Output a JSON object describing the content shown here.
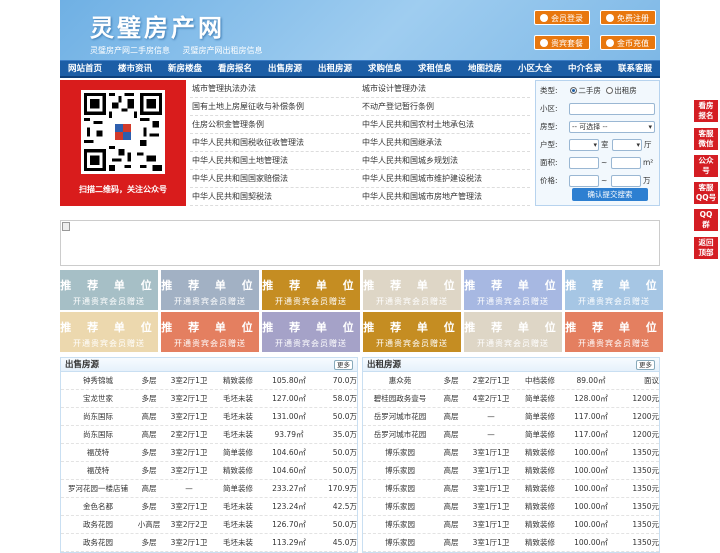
{
  "site": {
    "logo": "灵璧房产网",
    "subtitles": [
      "灵璧房产网二手房信息",
      "灵璧房产网出租房信息"
    ]
  },
  "header_buttons": [
    {
      "label": "会员登录",
      "icon": "user-icon"
    },
    {
      "label": "免费注册",
      "icon": "register-icon"
    },
    {
      "label": "贵宾套餐",
      "icon": "vip-icon"
    },
    {
      "label": "金币充值",
      "icon": "coin-icon"
    }
  ],
  "nav": [
    "网站首页",
    "楼市资讯",
    "新房楼盘",
    "看房报名",
    "出售房源",
    "出租房源",
    "求购信息",
    "求租信息",
    "地图找房",
    "小区大全",
    "中介名录",
    "联系客服"
  ],
  "qr": {
    "caption": "扫描二维码，关注公众号"
  },
  "links": [
    [
      "城市管理执法办法",
      "城市设计管理办法"
    ],
    [
      "国有土地上房屋征收与补偿条例",
      "不动产登记暂行条例"
    ],
    [
      "住房公积金管理条例",
      "中华人民共和国农村土地承包法"
    ],
    [
      "中华人民共和国税收征收管理法",
      "中华人民共和国继承法"
    ],
    [
      "中华人民共和国土地管理法",
      "中华人民共和国城乡规划法"
    ],
    [
      "中华人民共和国国家赔偿法",
      "中华人民共和国城市维护建设税法"
    ],
    [
      "中华人民共和国契税法",
      "中华人民共和国城市房地产管理法"
    ]
  ],
  "search": {
    "type_label": "类型:",
    "type_options": [
      "二手房",
      "出租房"
    ],
    "community_label": "小区:",
    "house_type_label": "房型:",
    "house_type_value": "-- 可选择 --",
    "layout_label": "户型:",
    "room_unit": "室",
    "hall_unit": "厅",
    "area_label": "面积:",
    "area_unit": "m²",
    "price_label": "价格:",
    "price_unit": "万",
    "range_sep": "~",
    "submit": "确认提交搜索"
  },
  "ads": {
    "title": "推 荐 单 位",
    "subtitle": "开通贵宾会员赠送",
    "colors": [
      "#a6bfc6",
      "#a2b1c4",
      "#c58d22",
      "#ded6c6",
      "#a7b8e2",
      "#a6c6e4",
      "#ecd8ae",
      "#e47f60",
      "#a5a2c8",
      "#c58d22",
      "#ded6c6",
      "#e47f60"
    ]
  },
  "sale": {
    "title": "出售房源",
    "more": "更多",
    "rows": [
      [
        "钟秀锦城",
        "多层",
        "3室2厅1卫",
        "精致装修",
        "105.80㎡",
        "70.0万"
      ],
      [
        "宝龙世家",
        "多层",
        "3室2厅1卫",
        "毛坯未装",
        "127.00㎡",
        "58.0万"
      ],
      [
        "尚东国际",
        "高层",
        "3室2厅1卫",
        "毛坯未装",
        "131.00㎡",
        "50.0万"
      ],
      [
        "尚东国际",
        "高层",
        "2室2厅1卫",
        "毛坯未装",
        "93.79㎡",
        "35.0万"
      ],
      [
        "福茂特",
        "多层",
        "3室2厅1卫",
        "简单装修",
        "104.60㎡",
        "50.0万"
      ],
      [
        "福茂特",
        "多层",
        "3室2厅1卫",
        "精致装修",
        "104.60㎡",
        "50.0万"
      ],
      [
        "罗河花园一楼店铺",
        "高层",
        "—",
        "简单装修",
        "233.27㎡",
        "170.9万"
      ],
      [
        "金色名都",
        "多层",
        "3室2厅1卫",
        "毛坯未装",
        "123.24㎡",
        "42.5万"
      ],
      [
        "政务花园",
        "小高层",
        "3室2厅2卫",
        "毛坯未装",
        "126.70㎡",
        "50.0万"
      ],
      [
        "政务花园",
        "多层",
        "3室2厅1卫",
        "毛坯未装",
        "113.29㎡",
        "45.0万"
      ]
    ]
  },
  "rent": {
    "title": "出租房源",
    "more": "更多",
    "rows": [
      [
        "惠众苑",
        "多层",
        "2室2厅1卫",
        "中档装修",
        "89.00㎡",
        "面议"
      ],
      [
        "碧桂园政务壹号",
        "高层",
        "4室2厅1卫",
        "简单装修",
        "128.00㎡",
        "1200元"
      ],
      [
        "岳罗河城市花园",
        "高层",
        "—",
        "简单装修",
        "117.00㎡",
        "1200元"
      ],
      [
        "岳罗河城市花园",
        "高层",
        "—",
        "简单装修",
        "117.00㎡",
        "1200元"
      ],
      [
        "博乐家园",
        "高层",
        "3室1厅1卫",
        "精致装修",
        "100.00㎡",
        "1350元"
      ],
      [
        "博乐家园",
        "高层",
        "3室1厅1卫",
        "精致装修",
        "100.00㎡",
        "1350元"
      ],
      [
        "博乐家园",
        "高层",
        "3室1厅1卫",
        "精致装修",
        "100.00㎡",
        "1350元"
      ],
      [
        "博乐家园",
        "高层",
        "3室1厅1卫",
        "精致装修",
        "100.00㎡",
        "1350元"
      ],
      [
        "博乐家园",
        "高层",
        "3室1厅1卫",
        "精致装修",
        "100.00㎡",
        "1350元"
      ],
      [
        "博乐家园",
        "高层",
        "3室1厅1卫",
        "精致装修",
        "100.00㎡",
        "1350元"
      ]
    ]
  },
  "side_buttons": [
    "看房报名",
    "客服微信",
    "公众号",
    "客服QQ号",
    "QQ群",
    "返回顶部"
  ]
}
